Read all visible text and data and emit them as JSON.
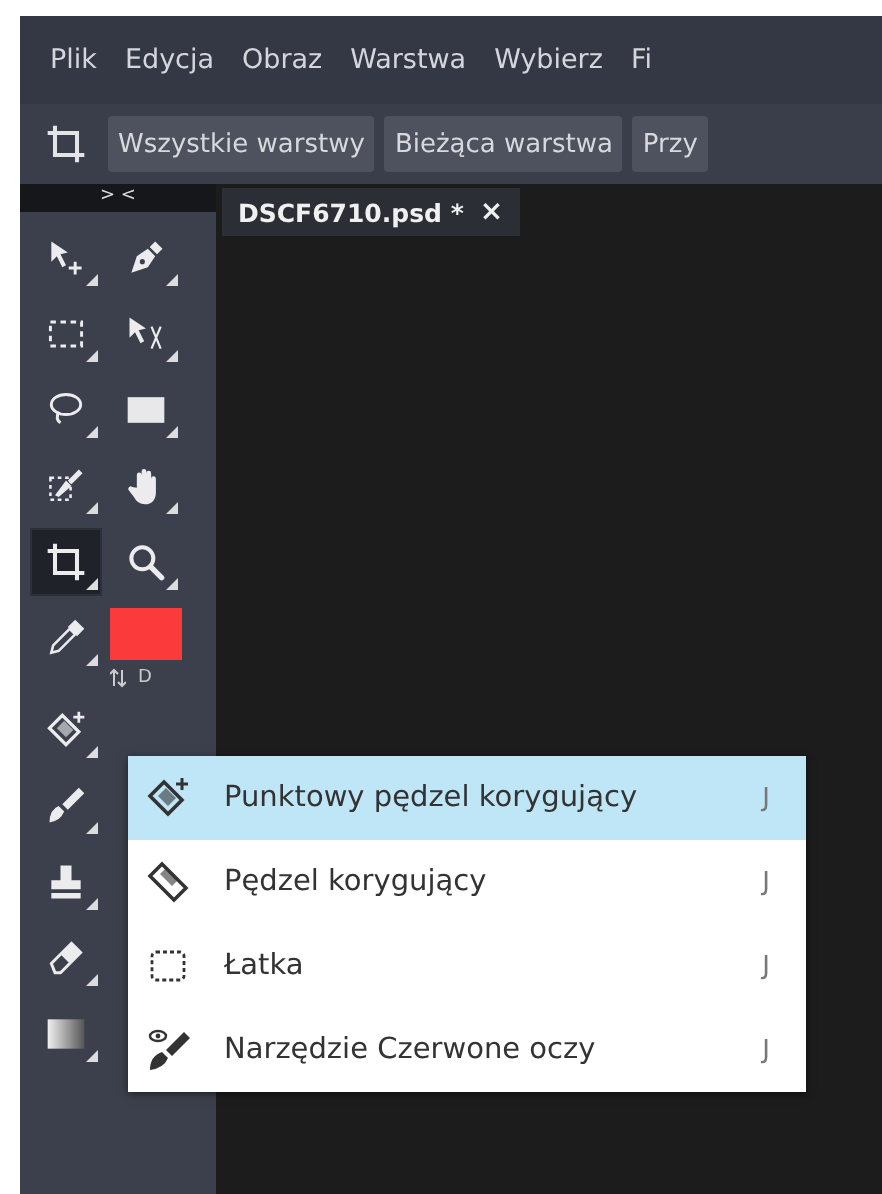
{
  "menu_bar": {
    "items": [
      "Plik",
      "Edycja",
      "Obraz",
      "Warstwa",
      "Wybierz",
      "Fi"
    ]
  },
  "options_bar": {
    "kind": "crop",
    "buttons": [
      "Wszystkie warstwy",
      "Bieżąca warstwa",
      "Przy"
    ]
  },
  "toolbox": {
    "collapse": "> <",
    "tool_rows": [
      [
        {
          "kind": "move",
          "selected": false
        },
        {
          "kind": "pen",
          "selected": false
        }
      ],
      [
        {
          "kind": "marquee",
          "selected": false
        },
        {
          "kind": "direct-select",
          "selected": false
        }
      ],
      [
        {
          "kind": "lasso",
          "selected": false
        },
        {
          "kind": "rectangle",
          "selected": false
        }
      ],
      [
        {
          "kind": "quick-select",
          "selected": false
        },
        {
          "kind": "hand",
          "selected": false
        }
      ],
      [
        {
          "kind": "crop",
          "selected": true
        },
        {
          "kind": "zoom",
          "selected": false
        }
      ],
      [
        {
          "kind": "eyedropper",
          "selected": false
        },
        {
          "kind": "color",
          "color": "#fb3b3b"
        }
      ],
      [
        {
          "kind": "spot-heal",
          "selected": false
        }
      ],
      [
        {
          "kind": "brush",
          "selected": false
        }
      ],
      [
        {
          "kind": "stamp",
          "selected": false
        }
      ],
      [
        {
          "kind": "eraser",
          "selected": false
        }
      ],
      [
        {
          "kind": "gradient",
          "selected": false
        }
      ]
    ],
    "color_controls": {
      "default": "D"
    }
  },
  "document_tab": {
    "title": "DSCF6710.psd *",
    "close": "×"
  },
  "tool_popup": {
    "items": [
      {
        "kind": "spot-heal",
        "label": "Punktowy pędzel korygujący",
        "shortcut": "J",
        "selected": true
      },
      {
        "kind": "heal",
        "label": "Pędzel korygujący",
        "shortcut": "J",
        "selected": false
      },
      {
        "kind": "patch",
        "label": "Łatka",
        "shortcut": "J",
        "selected": false
      },
      {
        "kind": "red-eye",
        "label": "Narzędzie Czerwone oczy",
        "shortcut": "J",
        "selected": false
      }
    ]
  }
}
